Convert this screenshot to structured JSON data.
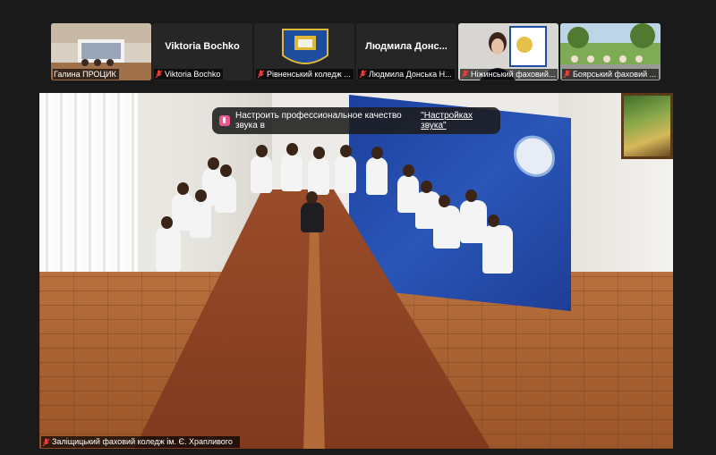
{
  "participants": [
    {
      "display_name": "",
      "label": "Галина ПРОЦИК",
      "muted": false
    },
    {
      "display_name": "Viktoria Bochko",
      "label": "Viktoria Bochko",
      "muted": true
    },
    {
      "display_name": "",
      "label": "Рівненський коледж ...",
      "muted": true
    },
    {
      "display_name": "Людмила  Донс...",
      "label": "Людмила Донська Н...",
      "muted": true
    },
    {
      "display_name": "",
      "label": "Ніжинський фаховий...",
      "muted": true
    },
    {
      "display_name": "",
      "label": "Боярський фаховий ...",
      "muted": true
    }
  ],
  "notification": {
    "text": "Настроить профессиональное качество звука в ",
    "link": "\"Настройках звука\""
  },
  "main_video": {
    "label": "Заліщицький фаховий коледж ім. Є. Храпливого",
    "muted": true
  },
  "colors": {
    "muted_icon": "#e5413a",
    "background": "#1a1a1a",
    "notify_accent": "#e7598f"
  }
}
